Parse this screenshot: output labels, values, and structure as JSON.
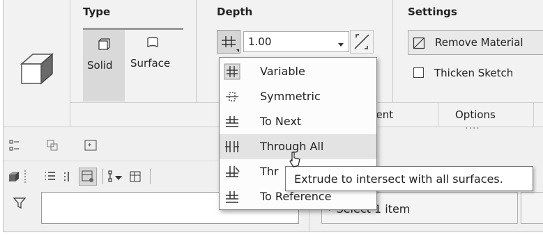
{
  "ribbon": {
    "type_group": {
      "title": "Type",
      "solid_label": "Solid",
      "surface_label": "Surface"
    },
    "depth_group": {
      "title": "Depth",
      "value": "1.00"
    },
    "settings_group": {
      "title": "Settings",
      "remove_material": "Remove Material",
      "thicken_sketch": "Thicken Sketch"
    },
    "tabs": {
      "placement_partial": "nent",
      "options": "Options",
      "dots": "...."
    }
  },
  "depth_menu": {
    "items": [
      {
        "label": "Variable",
        "icon": "variable-depth-icon"
      },
      {
        "label": "Symmetric",
        "icon": "symmetric-depth-icon"
      },
      {
        "label": "To Next",
        "icon": "to-next-icon"
      },
      {
        "label": "Through All",
        "icon": "through-all-icon"
      },
      {
        "label": "Thr",
        "icon": "through-until-icon"
      },
      {
        "label": "To Reference",
        "icon": "to-reference-icon"
      }
    ]
  },
  "tooltip": {
    "text": "Extrude to intersect with all surfaces."
  },
  "collector": {
    "text": "• Select 1 item"
  },
  "colors": {
    "ribbon_bg": "#f2f2f2",
    "selected_button": "#d9d9d9",
    "hover_row": "#e3e3e3"
  }
}
